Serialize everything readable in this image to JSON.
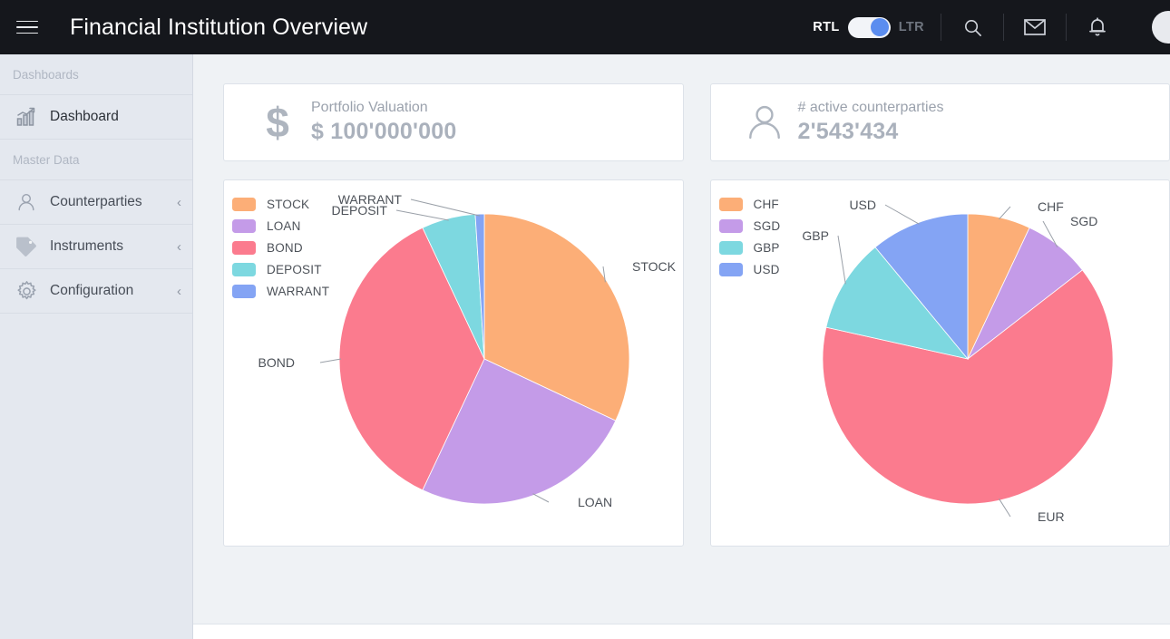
{
  "header": {
    "title": "Financial Institution Overview",
    "menu_icon": "hamburger-icon",
    "direction_toggle": {
      "left_label": "RTL",
      "right_label": "LTR",
      "active": "RTL",
      "knob_color": "#5b8def",
      "track_color": "#f2f4f8"
    },
    "actions": [
      {
        "name": "search-icon",
        "label": "Search"
      },
      {
        "name": "mail-icon",
        "label": "Messages"
      },
      {
        "name": "bell-icon",
        "label": "Notifications"
      }
    ],
    "avatar": "user-avatar",
    "background": "#15171c"
  },
  "sidebar": {
    "background": "#e4e8ef",
    "groups": [
      {
        "title": "Dashboards",
        "items": [
          {
            "label": "Dashboard",
            "icon": "bar-chart-growth-icon",
            "active": true,
            "expandable": false
          }
        ]
      },
      {
        "title": "Master Data",
        "items": [
          {
            "label": "Counterparties",
            "icon": "person-icon",
            "active": false,
            "expandable": true,
            "chevron": "‹"
          },
          {
            "label": "Instruments",
            "icon": "tag-icon",
            "active": false,
            "expandable": true,
            "chevron": "‹"
          },
          {
            "label": "Configuration",
            "icon": "gear-icon",
            "active": false,
            "expandable": true,
            "chevron": "‹"
          }
        ]
      }
    ]
  },
  "kpis": [
    {
      "icon": "dollar-sign-icon",
      "glyph": "$",
      "caption": "Portfolio Valuation",
      "value": "$ 100'000'000"
    },
    {
      "icon": "person-icon",
      "glyph": "",
      "caption": "# active counterparties",
      "value": "2'543'434"
    }
  ],
  "chart_data": [
    {
      "type": "pie",
      "title": "",
      "legend_position": "top-left",
      "categories": [
        "STOCK",
        "LOAN",
        "BOND",
        "DEPOSIT",
        "WARRANT"
      ],
      "values": [
        32,
        25,
        36,
        6,
        1
      ],
      "unit": "%",
      "colors": [
        "#fcae77",
        "#c49be8",
        "#fb7b8e",
        "#7dd8e0",
        "#84a4f4"
      ],
      "legend_entries": [
        "STOCK",
        "LOAN",
        "BOND",
        "DEPOSIT",
        "WARRANT"
      ],
      "annotations": [
        "STOCK",
        "LOAN",
        "BOND",
        "DEPOSIT",
        "WARRANT"
      ],
      "start_angle": 0,
      "direction": "clockwise"
    },
    {
      "type": "pie",
      "title": "",
      "legend_position": "top-left",
      "categories": [
        "CHF",
        "SGD",
        "EUR",
        "GBP",
        "USD"
      ],
      "values": [
        7,
        7.5,
        64,
        10.5,
        11
      ],
      "unit": "%",
      "colors": [
        "#fcae77",
        "#c49be8",
        "#fb7b8e",
        "#7dd8e0",
        "#84a4f4"
      ],
      "legend_entries": [
        "CHF",
        "SGD",
        "GBP",
        "USD"
      ],
      "annotations": [
        "CHF",
        "SGD",
        "EUR",
        "GBP",
        "USD"
      ],
      "start_angle": 0,
      "direction": "clockwise"
    }
  ],
  "theme": {
    "page_background": "#eff2f5",
    "card_background": "#ffffff",
    "card_border": "#dde2e9",
    "accent": "#5b8def",
    "muted_text": "#9ba2ad"
  }
}
